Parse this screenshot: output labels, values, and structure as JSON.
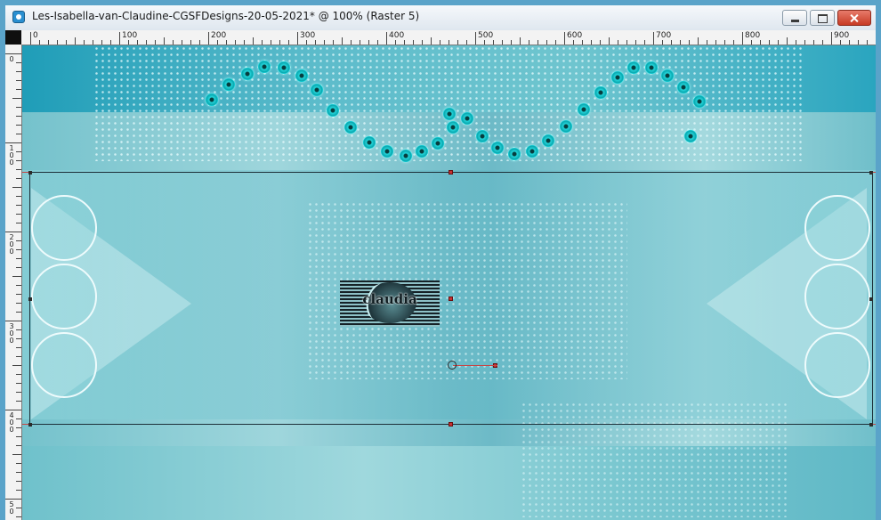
{
  "window": {
    "title": "Les-Isabella-van-Claudine-CGSFDesigns-20-05-2021* @ 100% (Raster 5)"
  },
  "ruler": {
    "horizontal_labels": [
      "0",
      "100",
      "200",
      "300",
      "400",
      "500",
      "600",
      "700",
      "800",
      "900"
    ],
    "vertical_labels": [
      "0",
      "1 0 0",
      "2 0 0",
      "3 0 0",
      "4 0 0",
      "5 0"
    ]
  },
  "canvas": {
    "watermark_text": "claudia"
  },
  "colors": {
    "accent": "#5aa3c9",
    "guide": "#c64545",
    "canvas_teal": "#75c2cc"
  },
  "icons": {
    "app": "paint-app-icon",
    "minimize": "minimize-icon",
    "maximize": "maximize-icon",
    "close": "close-icon"
  }
}
